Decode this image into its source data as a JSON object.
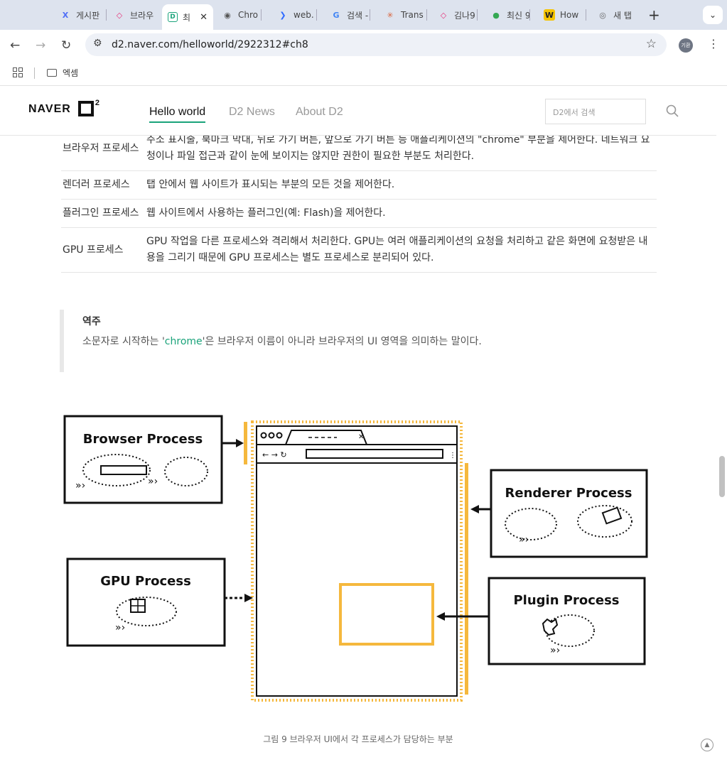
{
  "browser": {
    "tabs": [
      {
        "label": "게시판",
        "icon": "x-logo-icon",
        "color": "#4f6ef7"
      },
      {
        "label": "브라우",
        "icon": "clickup-icon",
        "color": "#e6337a"
      },
      {
        "label": "최",
        "icon": "d2-icon",
        "color": "#1aa37a",
        "active": true
      },
      {
        "label": "Chro",
        "icon": "chrome-doc-icon",
        "color": "#555555"
      },
      {
        "label": "web.",
        "icon": "arrow-logo-icon",
        "color": "#2f6bff"
      },
      {
        "label": "검색 -",
        "icon": "google-icon",
        "color": "#4285f4"
      },
      {
        "label": "Trans",
        "icon": "asterisk-icon",
        "color": "#d9623b"
      },
      {
        "label": "김나9",
        "icon": "clickup-icon",
        "color": "#e6337a"
      },
      {
        "label": "최신 9",
        "icon": "chrome-icon",
        "color": "#34a853"
      },
      {
        "label": "How",
        "icon": "w-logo-icon",
        "color": "#f5c400"
      },
      {
        "label": "새 탭",
        "icon": "chrome-icon",
        "color": "#666666"
      }
    ],
    "url": "d2.naver.com/helloworld/2922312#ch8",
    "profile_initials": "기환",
    "bookmark_folder": "엑셈"
  },
  "site": {
    "logo_text": "NAVER",
    "logo_d2": "D",
    "logo_sup": "2",
    "nav": [
      "Hello world",
      "D2 News",
      "About D2"
    ],
    "search_placeholder": "D2에서 검색"
  },
  "table": {
    "rows": [
      {
        "name": "브라우저 프로세스",
        "desc": "주소 표시줄, 북마크 막대, 뒤로 가기 버튼, 앞으로 가기 버튼 등 애플리케이션의 \"chrome\" 부분을 제어한다. 네트워크 요청이나 파일 접근과 같이 눈에 보이지는 않지만 권한이 필요한 부분도 처리한다."
      },
      {
        "name": "렌더러 프로세스",
        "desc": "탭 안에서 웹 사이트가 표시되는 부분의 모든 것을 제어한다."
      },
      {
        "name": "플러그인 프로세스",
        "desc": "웹 사이트에서 사용하는 플러그인(예: Flash)을 제어한다."
      },
      {
        "name": "GPU 프로세스",
        "desc": "GPU 작업을 다른 프로세스와 격리해서 처리한다. GPU는 여러 애플리케이션의 요청을 처리하고 같은 화면에 요청받은 내용을 그리기 때문에 GPU 프로세스는 별도 프로세스로 분리되어 있다."
      }
    ]
  },
  "note": {
    "title": "역주",
    "text_before": "소문자로 시작하는 '",
    "highlight": "chrome",
    "text_after": "'은 브라우저 이름이 아니라 브라우저의 UI 영역을 의미하는 말이다."
  },
  "figure": {
    "boxes": {
      "browser": "Browser Process",
      "gpu": "GPU Process",
      "renderer": "Renderer Process",
      "plugin": "Plugin Process"
    },
    "accent_color": "#f5b83d"
  },
  "caption": "그림 9 브라우저 UI에서 각 프로세스가 담당하는 부분"
}
